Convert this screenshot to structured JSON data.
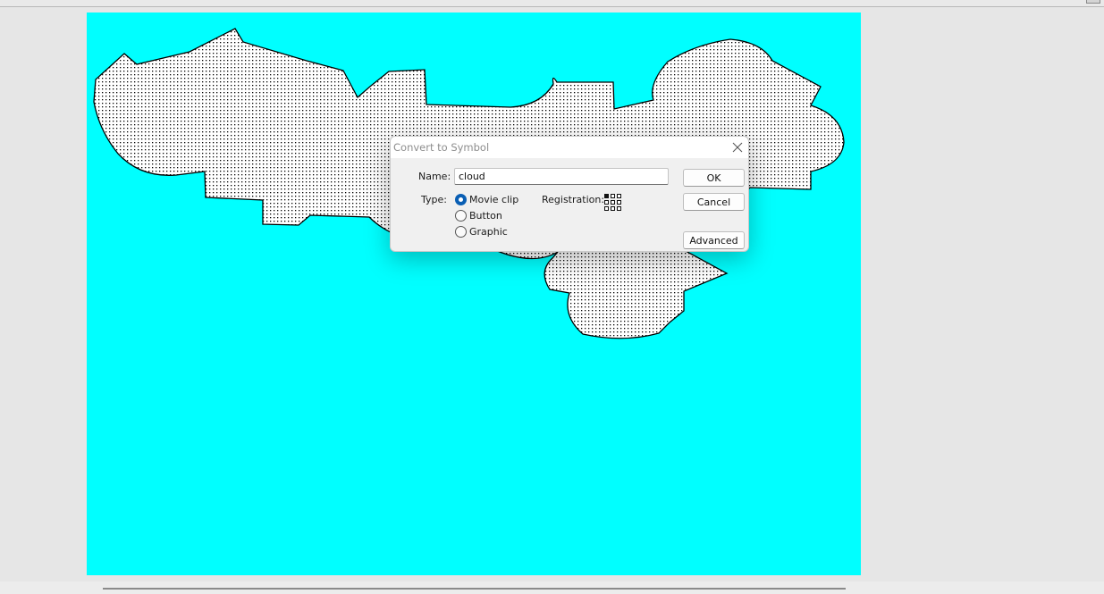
{
  "dialog": {
    "title": "Convert to Symbol",
    "name_label": "Name:",
    "name_value": "cloud",
    "type_label": "Type:",
    "type_options": [
      {
        "label": "Movie clip",
        "selected": true
      },
      {
        "label": "Button",
        "selected": false
      },
      {
        "label": "Graphic",
        "selected": false
      }
    ],
    "registration_label": "Registration:",
    "registration_point": "top-left",
    "buttons": {
      "ok": "OK",
      "cancel": "Cancel",
      "advanced": "Advanced"
    },
    "close_icon": "close-icon"
  },
  "stage": {
    "background_color": "#00ffff",
    "shape_fill": "dotted-pattern",
    "shape_stroke": "#000000"
  },
  "colors": {
    "accent": "#0a5fb4",
    "workspace": "#e6e6e6"
  }
}
